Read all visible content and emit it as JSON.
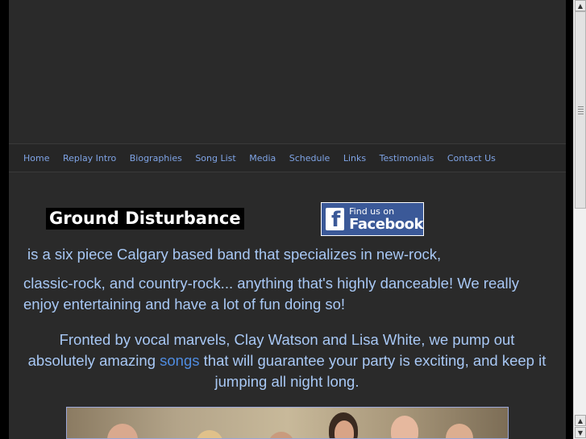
{
  "nav": {
    "items": [
      {
        "label": "Home"
      },
      {
        "label": "Replay Intro"
      },
      {
        "label": "Biographies"
      },
      {
        "label": "Song List"
      },
      {
        "label": "Media"
      },
      {
        "label": "Schedule"
      },
      {
        "label": "Links"
      },
      {
        "label": "Testimonials"
      },
      {
        "label": "Contact Us"
      }
    ]
  },
  "content": {
    "band_name": "Ground Disturbance",
    "facebook_badge": {
      "small": "Find us on",
      "big": "Facebook"
    },
    "para1": "is a six piece Calgary based band that specializes in new-rock,",
    "para2": "classic-rock,  and country-rock... anything that's highly danceable! We really enjoy entertaining and have a lot of fun doing so!",
    "para3_before": "Fronted by vocal marvels, Clay Watson and Lisa White, we pump out absolutely amazing ",
    "para3_link": "songs",
    "para3_after": " that will guarantee your party is exciting, and keep it jumping all night long."
  },
  "colors": {
    "text": "#a8c8f5",
    "nav_link": "#7fa4e6",
    "link": "#4f8ce0",
    "facebook": "#3b5998"
  },
  "icons": {
    "scroll_up": "up-arrow-icon",
    "scroll_down": "down-arrow-icon",
    "facebook": "facebook-f-icon"
  }
}
